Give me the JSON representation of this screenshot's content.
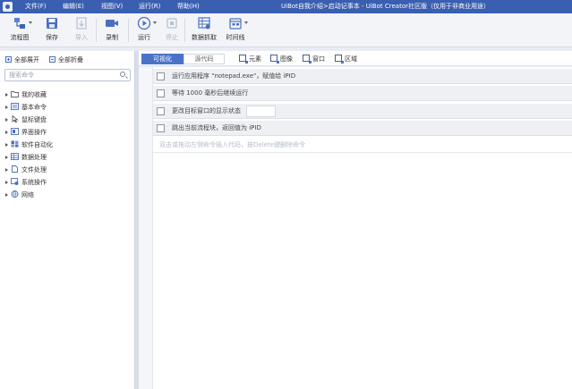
{
  "titlebar": {
    "menus": [
      "文件(F)",
      "编辑(E)",
      "视图(V)",
      "运行(R)",
      "帮助(H)"
    ],
    "title": "UiBot自我介绍>启动记事本 - UiBot Creator社区版（仅用于非商业用途）"
  },
  "toolbar": {
    "items": [
      {
        "label": "流程图",
        "icon": "flowchart-icon",
        "dropdown": true,
        "disabled": false
      },
      {
        "label": "保存",
        "icon": "save-icon",
        "dropdown": false,
        "disabled": false
      },
      {
        "label": "导入",
        "icon": "import-icon",
        "dropdown": false,
        "disabled": true
      },
      {
        "label": "录制",
        "icon": "record-icon",
        "dropdown": false,
        "disabled": false
      },
      {
        "label": "运行",
        "icon": "run-icon",
        "dropdown": true,
        "disabled": false
      },
      {
        "label": "停止",
        "icon": "stop-icon",
        "dropdown": false,
        "disabled": true
      },
      {
        "label": "数据抓取",
        "icon": "data-scrape-icon",
        "dropdown": false,
        "disabled": false
      },
      {
        "label": "时间线",
        "icon": "timeline-icon",
        "dropdown": true,
        "disabled": false
      }
    ]
  },
  "left_panel": {
    "expand_all": "全部展开",
    "collapse_all": "全部折叠",
    "search_placeholder": "搜索命令",
    "tree": [
      {
        "label": "我的收藏",
        "icon": "folder-icon"
      },
      {
        "label": "基本命令",
        "icon": "basic-command-icon"
      },
      {
        "label": "鼠标键盘",
        "icon": "mouse-keyboard-icon"
      },
      {
        "label": "界面操作",
        "icon": "ui-operation-icon"
      },
      {
        "label": "软件自动化",
        "icon": "software-automation-icon"
      },
      {
        "label": "数据处理",
        "icon": "data-processing-icon"
      },
      {
        "label": "文件处理",
        "icon": "file-processing-icon"
      },
      {
        "label": "系统操作",
        "icon": "system-operation-icon"
      },
      {
        "label": "网络",
        "icon": "network-icon"
      }
    ]
  },
  "editor": {
    "tabs": {
      "visual": "可视化",
      "source": "源代码"
    },
    "tools": {
      "element": "元素",
      "image": "图像",
      "window": "窗口",
      "region": "区域"
    },
    "rows": [
      {
        "text": "运行应用程序 \"notepad.exe\"，赋值给 iPID",
        "icon": "run-app-icon"
      },
      {
        "text": "等待 1000 毫秒后继续运行",
        "icon": "wait-icon"
      },
      {
        "text": "更改目标窗口的显示状态",
        "icon": "window-state-icon"
      },
      {
        "text": "跳出当前流程块，返回值为 iPID",
        "icon": "exit-block-icon"
      }
    ],
    "hint": "双击或拖动左侧命令插入代码，按Delete键删除命令"
  },
  "colors": {
    "titlebar": "#3a5fb1",
    "accent": "#4a73c7"
  }
}
